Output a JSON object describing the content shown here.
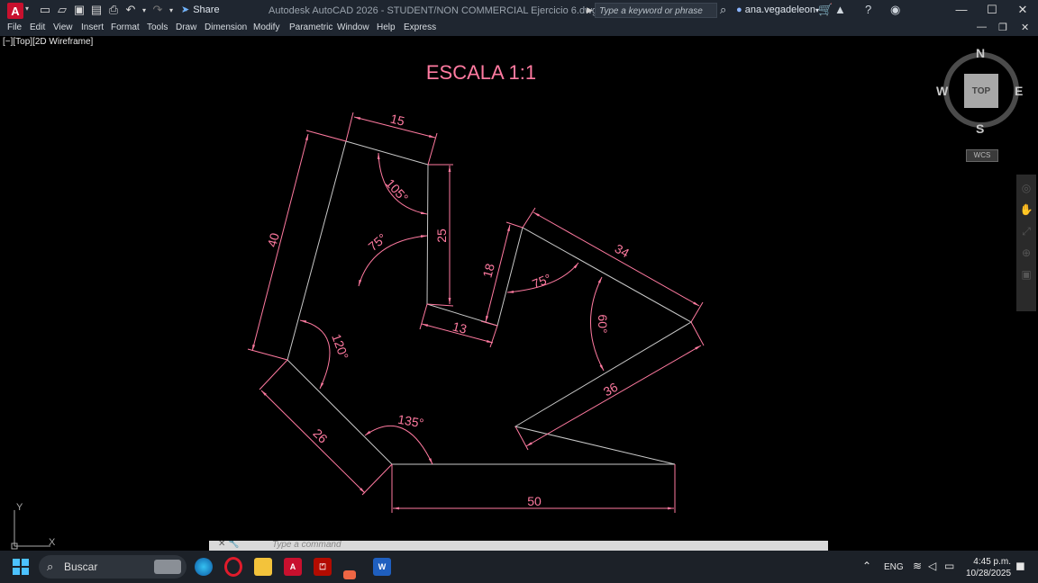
{
  "titlebar": {
    "app_letter": "A",
    "share_label": "Share",
    "title": "Autodesk AutoCAD 2026 - STUDENT/NON COMMERCIAL    Ejercicio 6.dwg",
    "search_placeholder": "Type a keyword or phrase",
    "username": "ana.vegadeleon",
    "icons": [
      "new-icon",
      "open-icon",
      "save-icon",
      "saveas-icon",
      "print-icon",
      "undo-icon",
      "redo-icon",
      "share-icon",
      "search-icon",
      "user-icon",
      "cart-icon",
      "autodesk-icon",
      "help-icon",
      "minimize-icon",
      "maximize-icon",
      "close-icon"
    ]
  },
  "menubar": {
    "items": [
      "File",
      "Edit",
      "View",
      "Insert",
      "Format",
      "Tools",
      "Draw",
      "Dimension",
      "Modify",
      "Parametric",
      "Window",
      "Help",
      "Express"
    ]
  },
  "viewport": {
    "label": "[−][Top][2D Wireframe]"
  },
  "drawing": {
    "title": "ESCALA 1:1",
    "color": "#ff7aa0",
    "dims": {
      "d15": "15",
      "d40": "40",
      "d25": "25",
      "d105": "105°",
      "d75a": "75°",
      "d120": "120°",
      "d13": "13",
      "d18": "18",
      "d75b": "75°",
      "d34": "34",
      "d60": "60°",
      "d36": "36",
      "d135": "135°",
      "d26": "26",
      "d50": "50"
    }
  },
  "viewcube": {
    "top_label": "TOP",
    "north": "N",
    "south": "S",
    "east": "E",
    "west": "W",
    "wcs_label": "WCS"
  },
  "ucs": {
    "x_label": "X",
    "y_label": "Y"
  },
  "command": {
    "placeholder": "Type a command"
  },
  "taskbar": {
    "search_label": "Buscar",
    "language": "ENG",
    "time": "4:45 p.m.",
    "date": "10/28/2025",
    "apps": [
      "edge",
      "opera",
      "explorer",
      "autocad",
      "acrobat",
      "snip",
      "word"
    ]
  }
}
